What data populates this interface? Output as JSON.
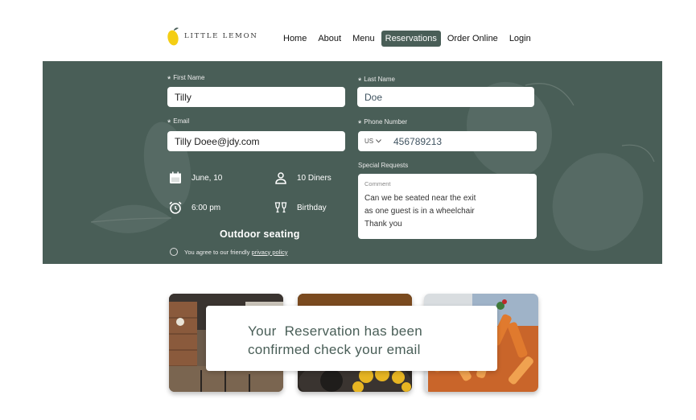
{
  "brand": {
    "name": "LITTLE LEMON"
  },
  "nav": {
    "items": [
      {
        "label": "Home"
      },
      {
        "label": "About"
      },
      {
        "label": "Menu"
      },
      {
        "label": "Reservations"
      },
      {
        "label": "Order Online"
      },
      {
        "label": "Login"
      }
    ],
    "active_index": 3
  },
  "form": {
    "first_name": {
      "label": "First Name",
      "value": "Tilly"
    },
    "last_name": {
      "label": "Last Name",
      "value": "Doe"
    },
    "email": {
      "label": "Email",
      "value": "Tilly Doee@jdy.com"
    },
    "phone": {
      "label": "Phone Number",
      "country": "US",
      "value": "456789213"
    },
    "date": {
      "icon": "calendar-icon",
      "value": "June, 10"
    },
    "diners": {
      "icon": "person-icon",
      "value": "10 Diners"
    },
    "time": {
      "icon": "alarm-clock-icon",
      "value": "6:00 pm"
    },
    "occasion": {
      "icon": "cheers-glasses-icon",
      "value": "Birthday"
    },
    "seating": "Outdoor seating",
    "special_requests": {
      "label": "Special Requests",
      "placeholder": "Comment",
      "lines": [
        "Can we be seated near the exit",
        "as one guest is in a wheelchair",
        "Thank you"
      ]
    },
    "agreement": {
      "prefix": "You agree to our friendly",
      "link": "privacy policy"
    }
  },
  "confirmation": {
    "line1": "Your  Reservation has been",
    "line2": "confirmed check your email"
  },
  "colors": {
    "primary": "#495e57",
    "accent": "#f4ce14",
    "white": "#ffffff"
  }
}
